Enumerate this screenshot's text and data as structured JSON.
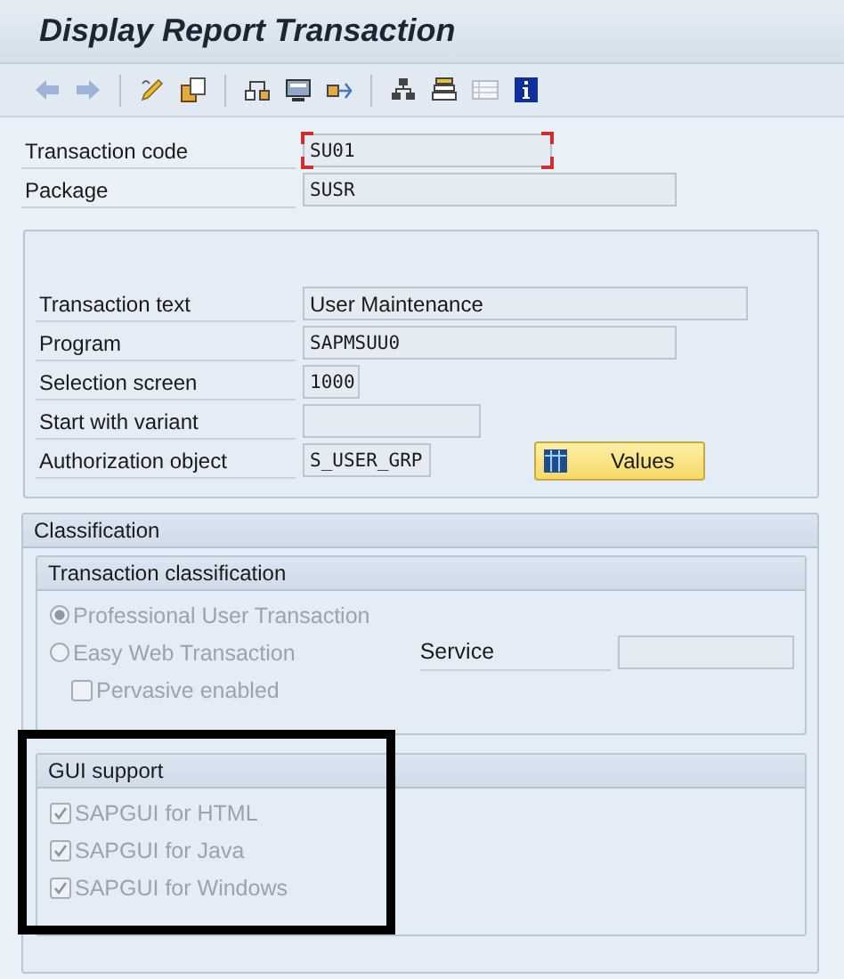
{
  "window": {
    "title": "Display Report Transaction"
  },
  "header_fields": [
    {
      "label": "Transaction code",
      "value": "SU01",
      "focused": true
    },
    {
      "label": "Package",
      "value": "SUSR",
      "focused": false
    }
  ],
  "details": [
    {
      "label": "Transaction text",
      "value": "User Maintenance"
    },
    {
      "label": "Program",
      "value": "SAPMSUU0"
    },
    {
      "label": "Selection screen",
      "value": "1000"
    },
    {
      "label": "Start with variant"
    },
    {
      "label": "Authorization object",
      "value": "S_USER_GRP"
    }
  ],
  "values_button": "Values",
  "classification": {
    "title": "Classification",
    "transaction_classification": {
      "title": "Transaction classification",
      "options": [
        {
          "label": "Professional User Transaction",
          "selected": true,
          "disabled": true
        },
        {
          "label": "Easy Web Transaction",
          "selected": false,
          "disabled": true
        }
      ],
      "pervasive": {
        "label": "Pervasive enabled",
        "checked": false,
        "disabled": true
      },
      "service": {
        "label": "Service"
      }
    },
    "gui_support": {
      "title": "GUI support",
      "options": [
        {
          "label": "SAPGUI for HTML",
          "checked": true,
          "disabled": true
        },
        {
          "label": "SAPGUI for Java",
          "checked": true,
          "disabled": true
        },
        {
          "label": "SAPGUI for Windows",
          "checked": true,
          "disabled": true
        }
      ]
    }
  }
}
